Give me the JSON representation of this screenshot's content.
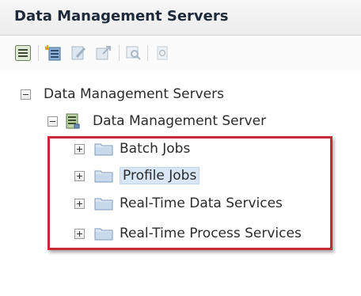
{
  "panel": {
    "title": "Data Management Servers"
  },
  "toolbar": {
    "buttons": [
      {
        "icon": "properties-icon",
        "enabled": true
      },
      {
        "icon": "new-server-icon",
        "enabled": true
      },
      {
        "icon": "edit-icon",
        "enabled": false
      },
      {
        "icon": "export-icon",
        "enabled": false
      },
      {
        "icon": "search-icon",
        "enabled": false
      },
      {
        "icon": "refresh-icon",
        "enabled": false
      }
    ]
  },
  "tree": {
    "root": {
      "label": "Data Management Servers",
      "expanded": true
    },
    "server": {
      "label": "Data Management Server",
      "expanded": true
    },
    "folders": [
      {
        "label": "Batch Jobs",
        "selected": false
      },
      {
        "label": "Profile Jobs",
        "selected": true
      },
      {
        "label": "Real-Time Data Services",
        "selected": false
      },
      {
        "label": "Real-Time Process Services",
        "selected": false
      }
    ]
  },
  "colors": {
    "highlight_border": "#c62a35",
    "selection_bg": "#d9e6f6"
  }
}
